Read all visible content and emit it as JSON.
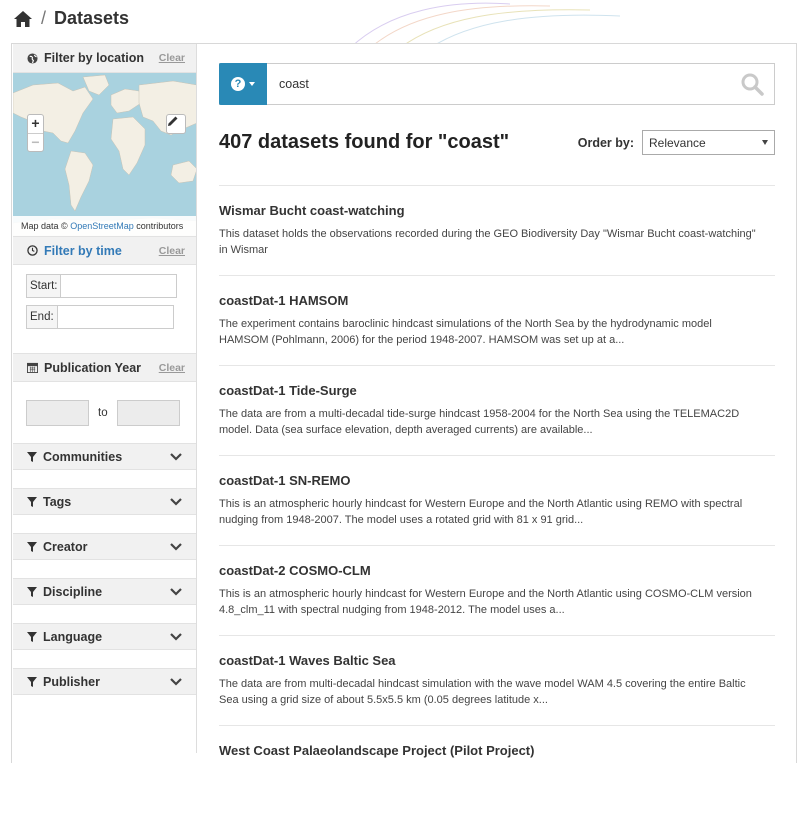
{
  "breadcrumb": {
    "title": "Datasets",
    "separator": "/"
  },
  "sidebar": {
    "location": {
      "heading": "Filter by location",
      "clear": "Clear",
      "zoom_in": "+",
      "zoom_out": "−",
      "attribution_prefix": "Map data ©",
      "attribution_link": "OpenStreetMap",
      "attribution_suffix": "contributors"
    },
    "time": {
      "heading": "Filter by time",
      "clear": "Clear",
      "start_label": "Start:",
      "end_label": "End:",
      "start_value": "",
      "end_value": ""
    },
    "year": {
      "heading": "Publication Year",
      "clear": "Clear",
      "to_label": "to",
      "from_value": "",
      "to_value": ""
    },
    "facets": [
      "Communities",
      "Tags",
      "Creator",
      "Discipline",
      "Language",
      "Publisher"
    ]
  },
  "search": {
    "query": "coast",
    "help_symbol": "?"
  },
  "results_header": {
    "count_text": "407 datasets found for \"coast\"",
    "order_label": "Order by:",
    "order_value": "Relevance"
  },
  "results": [
    {
      "title": "Wismar Bucht coast-watching",
      "desc_line1": "This dataset holds the observations recorded during the GEO Biodiversity Day \"Wismar Bucht coast-watching\"",
      "desc_line2": "in Wismar"
    },
    {
      "title": "coastDat-1 HAMSOM",
      "desc_line1": "The experiment contains baroclinic hindcast simulations of the North Sea by the hydrodynamic model",
      "desc_line2": "HAMSOM (Pohlmann, 2006) for the period 1948-2007. HAMSOM was set up at a..."
    },
    {
      "title": "coastDat-1 Tide-Surge",
      "desc_line1": "The data are from a multi-decadal tide-surge hindcast 1958-2004 for the North Sea using the TELEMAC2D",
      "desc_line2": "model. Data (sea surface elevation, depth averaged currents) are available..."
    },
    {
      "title": "coastDat-1 SN-REMO",
      "desc_line1": "This is an atmospheric hourly hindcast for Western Europe and the North Atlantic using REMO with spectral",
      "desc_line2": "nudging from 1948-2007. The model uses a rotated grid with 81 x 91 grid..."
    },
    {
      "title": "coastDat-2 COSMO-CLM",
      "desc_line1": "This is an atmospheric hourly hindcast for Western Europe and the North Atlantic using COSMO-CLM version",
      "desc_line2": "4.8_clm_11 with spectral nudging from 1948-2012. The model uses a..."
    },
    {
      "title": "coastDat-1 Waves Baltic Sea",
      "desc_line1": "The data are from multi-decadal hindcast simulation with the wave model WAM 4.5 covering the entire Baltic",
      "desc_line2": "Sea using a grid size of about 5.5x5.5 km (0.05 degrees latitude x..."
    },
    {
      "title": "West Coast Palaeolandscape Project (Pilot Project)",
      "desc_line1": "",
      "desc_line2": ""
    }
  ],
  "colors": {
    "accent": "#2989b6",
    "link": "#337ab7",
    "panel_bg": "#f1f1f1",
    "map_water": "#a9d2df",
    "map_land": "#f3efe4"
  }
}
